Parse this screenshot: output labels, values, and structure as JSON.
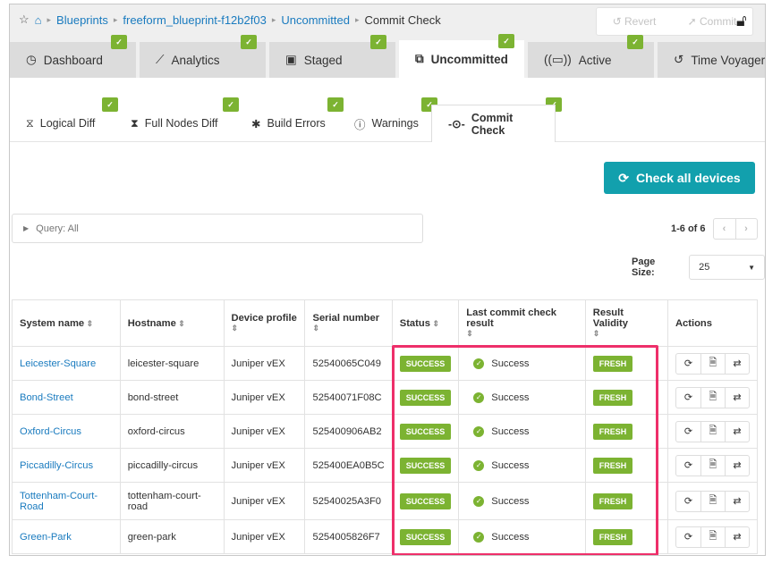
{
  "breadcrumb": {
    "items": [
      "Blueprints",
      "freeform_blueprint-f12b2f03",
      "Uncommitted"
    ],
    "current": "Commit Check"
  },
  "top_actions": {
    "revert": "Revert",
    "commit": "Commit"
  },
  "tabs": [
    {
      "label": "Dashboard",
      "icon": "⓵"
    },
    {
      "label": "Analytics",
      "icon": "⟋"
    },
    {
      "label": "Staged",
      "icon": "▣"
    },
    {
      "label": "Uncommitted",
      "icon": "⧉"
    },
    {
      "label": "Active",
      "icon": "((▭))"
    },
    {
      "label": "Time Voyager",
      "icon": "↺"
    }
  ],
  "subtabs": [
    {
      "label": "Logical Diff"
    },
    {
      "label": "Full Nodes Diff"
    },
    {
      "label": "Build Errors"
    },
    {
      "label": "Warnings"
    },
    {
      "label": "Commit Check"
    }
  ],
  "check_all_label": "Check all devices",
  "query": "Query: All",
  "pager": {
    "range": "1-6 of 6"
  },
  "page_size": {
    "label": "Page Size:",
    "value": "25"
  },
  "columns": [
    "System name",
    "Hostname",
    "Device profile",
    "Serial number",
    "Status",
    "Last commit check result",
    "Result Validity",
    "Actions"
  ],
  "rows": [
    {
      "system": "Leicester-Square",
      "host": "leicester-square",
      "profile": "Juniper vEX",
      "serial": "52540065C049",
      "status": "SUCCESS",
      "result": "Success",
      "validity": "FRESH"
    },
    {
      "system": "Bond-Street",
      "host": "bond-street",
      "profile": "Juniper vEX",
      "serial": "52540071F08C",
      "status": "SUCCESS",
      "result": "Success",
      "validity": "FRESH"
    },
    {
      "system": "Oxford-Circus",
      "host": "oxford-circus",
      "profile": "Juniper vEX",
      "serial": "525400906AB2",
      "status": "SUCCESS",
      "result": "Success",
      "validity": "FRESH"
    },
    {
      "system": "Piccadilly-Circus",
      "host": "piccadilly-circus",
      "profile": "Juniper vEX",
      "serial": "525400EA0B5C",
      "status": "SUCCESS",
      "result": "Success",
      "validity": "FRESH"
    },
    {
      "system": "Tottenham-Court-Road",
      "host": "tottenham-court-road",
      "profile": "Juniper vEX",
      "serial": "52540025A3F0",
      "status": "SUCCESS",
      "result": "Success",
      "validity": "FRESH"
    },
    {
      "system": "Green-Park",
      "host": "green-park",
      "profile": "Juniper vEX",
      "serial": "5254005826F7",
      "status": "SUCCESS",
      "result": "Success",
      "validity": "FRESH"
    }
  ],
  "colors": {
    "accent": "#12a0ad",
    "success": "#7cb332",
    "highlight": "#ee2f6a",
    "link": "#1a7bbf"
  }
}
